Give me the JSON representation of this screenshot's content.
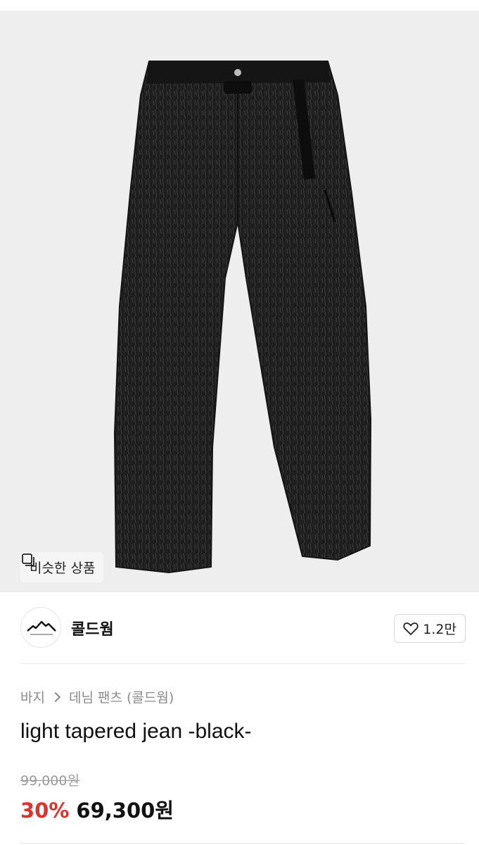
{
  "image": {
    "alt": "light tapered jean -black-",
    "background": "#eeeeee"
  },
  "similar_button": {
    "label": "비슷한 상품",
    "icon": "similar-items-icon"
  },
  "seller": {
    "name": "콜드웜",
    "avatar_icon": "mountain-logo-icon"
  },
  "like_button": {
    "icon": "heart-outline-icon",
    "count": "1.2만"
  },
  "breadcrumb": {
    "items": [
      "바지",
      "데님 팬츠 (콜드웜)"
    ],
    "separator_icon": "chevron-right-icon"
  },
  "product": {
    "title": "light tapered jean -black-",
    "original_price": "99,000원",
    "discount": "30%",
    "sale_price": "69,300원"
  },
  "colors": {
    "discount": "#e0312a",
    "muted_text": "#8a8a8a",
    "image_bg": "#eeeeee"
  }
}
